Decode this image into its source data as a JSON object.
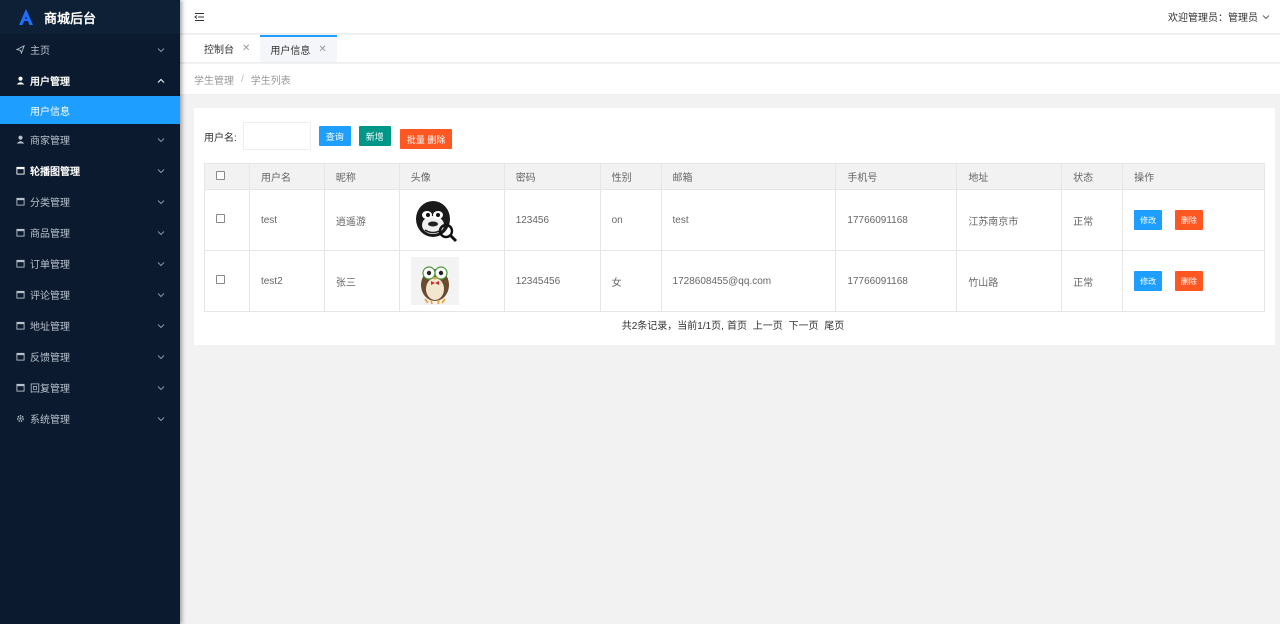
{
  "app": {
    "title": "商城后台"
  },
  "sidebar": {
    "items": [
      {
        "label": "主页",
        "icon": "send-icon"
      },
      {
        "label": "用户管理",
        "icon": "user-icon"
      },
      {
        "label": "商家管理",
        "icon": "user-icon"
      },
      {
        "label": "轮播图管理",
        "icon": "calendar-icon"
      },
      {
        "label": "分类管理",
        "icon": "calendar-icon"
      },
      {
        "label": "商品管理",
        "icon": "calendar-icon"
      },
      {
        "label": "订单管理",
        "icon": "calendar-icon"
      },
      {
        "label": "评论管理",
        "icon": "calendar-icon"
      },
      {
        "label": "地址管理",
        "icon": "calendar-icon"
      },
      {
        "label": "反馈管理",
        "icon": "calendar-icon"
      },
      {
        "label": "回复管理",
        "icon": "calendar-icon"
      },
      {
        "label": "系统管理",
        "icon": "gear-icon"
      }
    ],
    "submenu": {
      "label": "用户信息"
    }
  },
  "header": {
    "welcome": "欢迎管理员：",
    "username": "管理员"
  },
  "tabs": [
    {
      "label": "控制台"
    },
    {
      "label": "用户信息"
    }
  ],
  "breadcrumb": {
    "parent": "学生管理",
    "separator": "/",
    "current": "学生列表"
  },
  "search": {
    "label": "用户名:",
    "value": "",
    "query_label": "查询",
    "add_label": "新增",
    "batch_delete_label": "批量 删除"
  },
  "table": {
    "headers": [
      "用户名",
      "昵称",
      "头像",
      "密码",
      "性别",
      "邮箱",
      "手机号",
      "地址",
      "状态",
      "操作"
    ],
    "rows": [
      {
        "username": "test",
        "nickname": "逍遥游",
        "avatar": "gorilla-avatar",
        "password": "123456",
        "gender": "on",
        "email": "test",
        "phone": "17766091168",
        "address": "江苏南京市",
        "status": "正常"
      },
      {
        "username": "test2",
        "nickname": "张三",
        "avatar": "owl-avatar",
        "password": "12345456",
        "gender": "女",
        "email": "1728608455@qq.com",
        "phone": "17766091168",
        "address": "竹山路",
        "status": "正常"
      }
    ],
    "edit_label": "修改",
    "delete_label": "删除"
  },
  "pager": {
    "summary": "共2条记录，当前1/1页,",
    "first": "首页",
    "prev": "上一页",
    "next": "下一页",
    "last": "尾页"
  },
  "colors": {
    "sidebar_bg": "#0b1a2e",
    "accent_blue": "#1e9fff",
    "teal": "#009688",
    "orange": "#ff5722"
  }
}
